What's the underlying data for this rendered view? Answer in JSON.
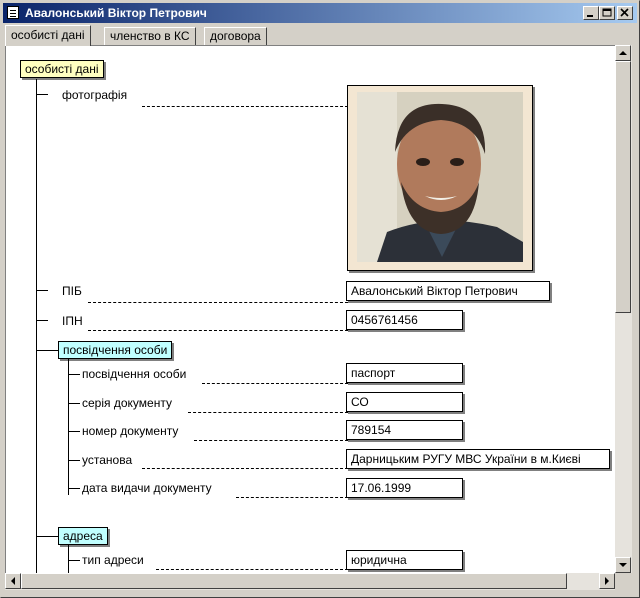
{
  "window": {
    "title": "Авалонський Віктор Петрович"
  },
  "tabs": [
    "особисті дані",
    "членство в КС",
    "договора"
  ],
  "tree": {
    "root_label": "особисті дані",
    "photo_label": "фотографія",
    "pib_label": "ПІБ",
    "pib_value": "Авалонський Віктор Петрович",
    "ipn_label": "ІПН",
    "ipn_value": "0456761456",
    "id_group_label": "посвідчення особи",
    "id_fields": [
      {
        "label": "посвідчення особи",
        "value": "паспорт"
      },
      {
        "label": "серія документу",
        "value": "СО"
      },
      {
        "label": "номер документу",
        "value": "789154"
      },
      {
        "label": "установа",
        "value": "Дарницьким РУГУ МВС України в м.Києві"
      },
      {
        "label": "дата видачи документу",
        "value": "17.06.1999"
      }
    ],
    "address_group_label": "адреса",
    "address_fields": [
      {
        "label": "тип адреси",
        "value": "юридична"
      }
    ]
  },
  "colors": {
    "root_label_bg": "#ffffc0",
    "group_label_bg": "#c0ffff",
    "titlebar_start": "#0a246a",
    "titlebar_end": "#a6caf0"
  },
  "icons": {
    "app": "document-icon",
    "minimize": "minimize-icon",
    "maximize": "maximize-icon",
    "close": "close-icon"
  }
}
